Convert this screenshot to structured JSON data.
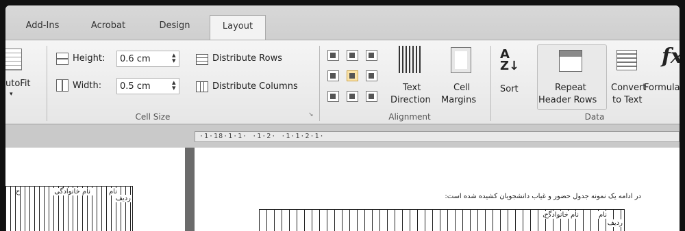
{
  "tabs": [
    {
      "label": "Add-Ins",
      "active": false
    },
    {
      "label": "Acrobat",
      "active": false
    },
    {
      "label": "Design",
      "active": false
    },
    {
      "label": "Layout",
      "active": true
    }
  ],
  "ribbon": {
    "autofit": {
      "label": "utoFit"
    },
    "cell_size": {
      "height_label": "Height:",
      "height_value": "0.6 cm",
      "width_label": "Width:",
      "width_value": "0.5 cm",
      "distribute_rows": "Distribute Rows",
      "distribute_columns": "Distribute Columns",
      "group_label": "Cell Size"
    },
    "alignment": {
      "text_direction": [
        "Text",
        "Direction"
      ],
      "cell_margins": [
        "Cell",
        "Margins"
      ],
      "group_label": "Alignment"
    },
    "data": {
      "sort": "Sort",
      "repeat_header_rows": [
        "Repeat",
        "Header Rows"
      ],
      "convert_to_text": [
        "Convert",
        "to Text"
      ],
      "formula": "Formula",
      "group_label": "Data"
    }
  },
  "ruler": {
    "text": "·1·18·1·1· ·1·2· ·1·1·2·1·"
  },
  "document": {
    "caption": "در ادامه یک نمونه جدول حضور و غیاب دانشجویان کشیده شده است:",
    "headers": {
      "name": "نام",
      "family": "نام خانوادگی",
      "row": "ردیف",
      "ha": "ح"
    }
  },
  "colors": {
    "accent_selected": "#fbe3a8",
    "ribbon_bg": "#f0f0f0"
  }
}
